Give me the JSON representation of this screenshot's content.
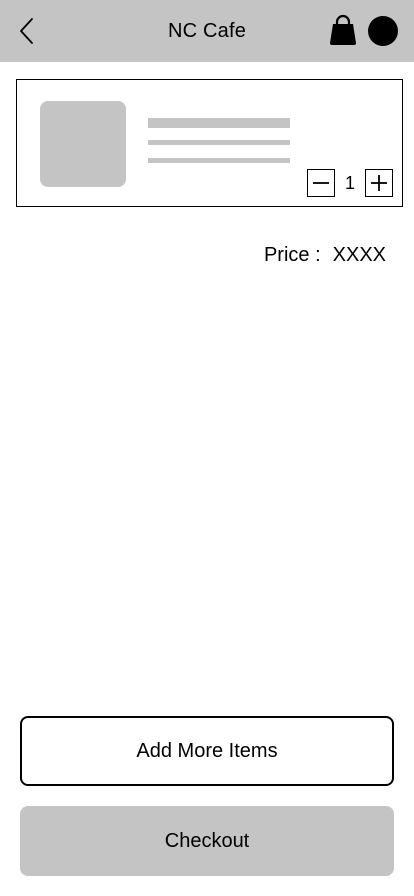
{
  "header": {
    "title": "NC Cafe",
    "background": "#c4c4c4",
    "back_icon": "chevron-left-icon",
    "bag_icon": "shopping-bag-icon",
    "avatar": "profile-avatar"
  },
  "cart": {
    "items": [
      {
        "image": "placeholder",
        "quantity": "1",
        "decrement_icon": "minus-icon",
        "increment_icon": "plus-icon"
      }
    ]
  },
  "price": {
    "label": "Price :",
    "value": "XXXX"
  },
  "actions": {
    "add_more_label": "Add More Items",
    "checkout_label": "Checkout",
    "checkout_color": "#c4c4c4"
  }
}
